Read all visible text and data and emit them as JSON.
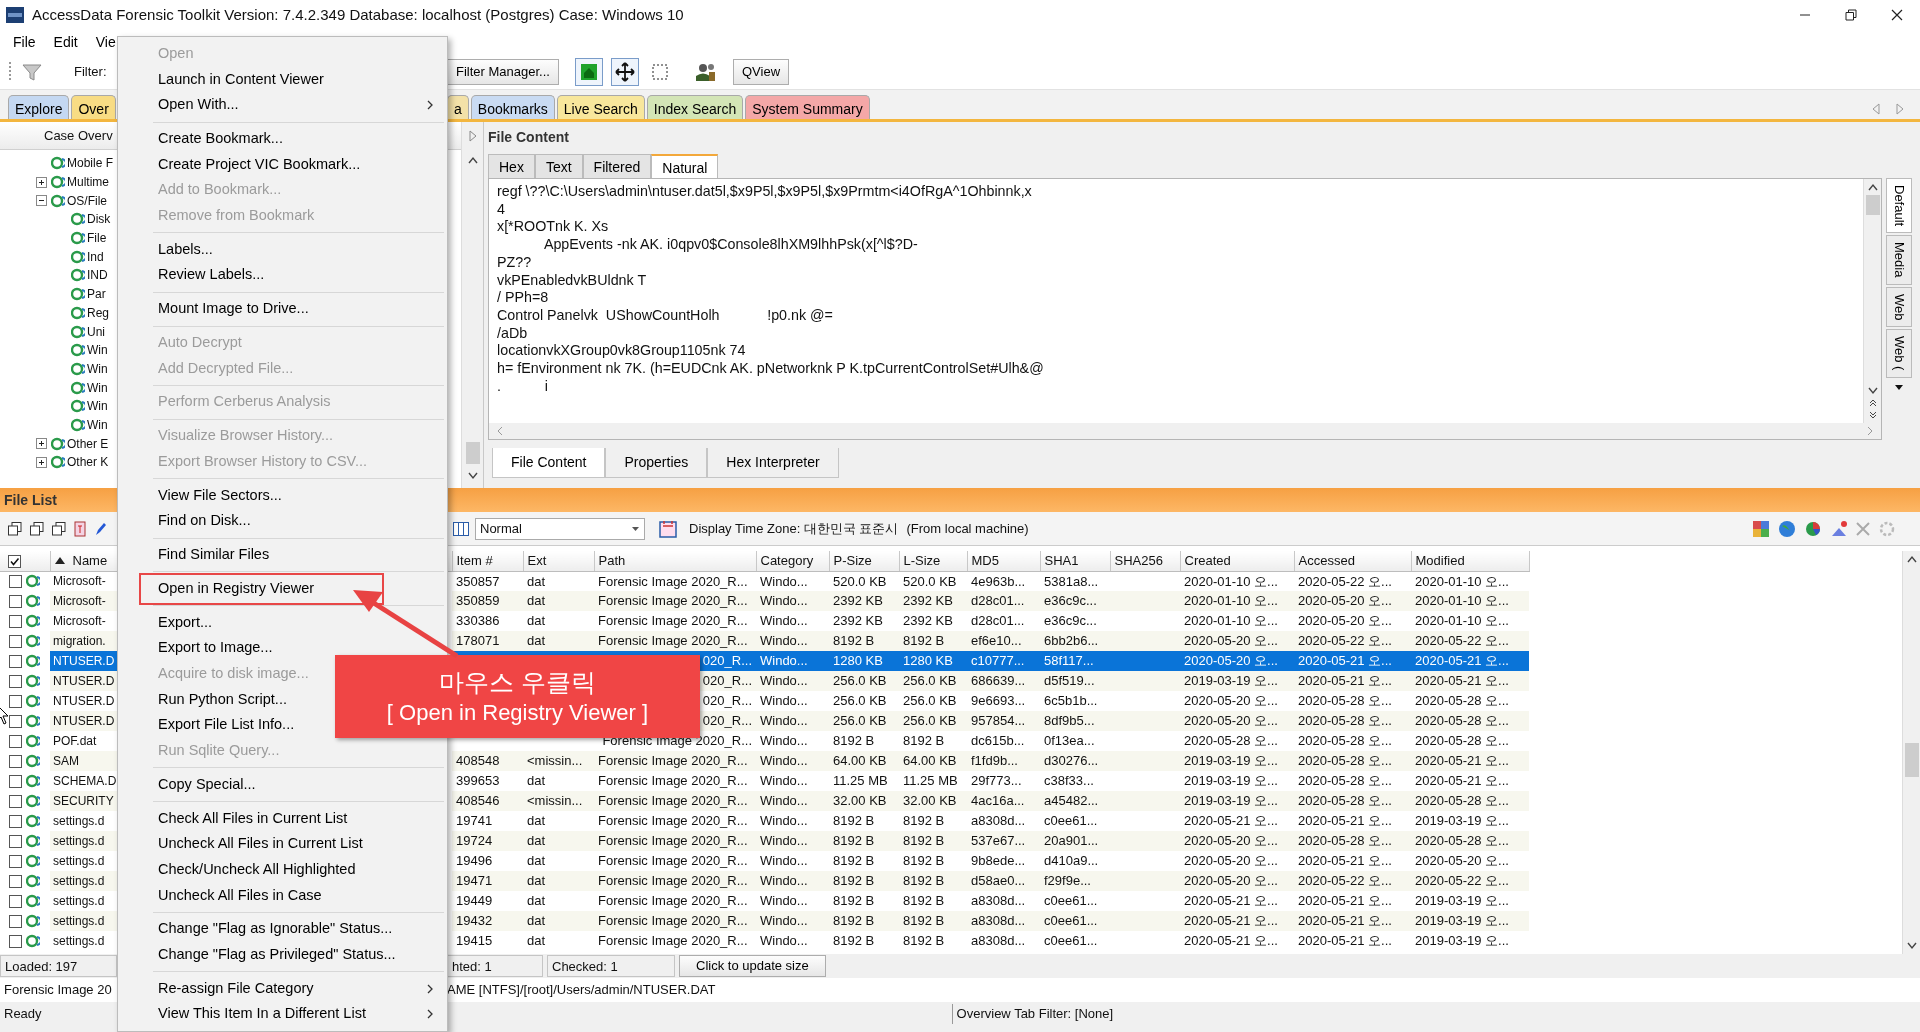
{
  "window": {
    "title": "AccessData Forensic Toolkit Version: 7.4.2.349 Database: localhost (Postgres) Case: Windows 10"
  },
  "menu_bar": [
    "File",
    "Edit",
    "Vie"
  ],
  "toolbar": {
    "filter_label": "Filter:",
    "filter_manager": "Filter Manager...",
    "qview": "QView"
  },
  "tabs": [
    {
      "label": "Explore",
      "color": "#c4d8f2"
    },
    {
      "label": "Over",
      "color": "#f8dc84"
    },
    {
      "label": "a",
      "color": "#f3e1a8"
    },
    {
      "label": "Bookmarks",
      "color": "#c9dbf3"
    },
    {
      "label": "Live Search",
      "color": "#f8e79c"
    },
    {
      "label": "Index Search",
      "color": "#d3e5b6"
    },
    {
      "label": "System Summary",
      "color": "#f4a7a7"
    }
  ],
  "tree": {
    "header": "Case Overv",
    "items": [
      {
        "label": "Mobile F"
      },
      {
        "label": "Multime",
        "expanded": false
      },
      {
        "label": "OS/File",
        "expanded": true,
        "children": [
          {
            "label": "Disk"
          },
          {
            "label": "File"
          },
          {
            "label": "Ind"
          },
          {
            "label": "IND"
          },
          {
            "label": "Par"
          },
          {
            "label": "Reg"
          },
          {
            "label": "Uni"
          },
          {
            "label": "Win"
          },
          {
            "label": "Win"
          },
          {
            "label": "Win"
          },
          {
            "label": "Win"
          },
          {
            "label": "Win"
          }
        ]
      },
      {
        "label": "Other E",
        "expanded": false
      },
      {
        "label": "Other K",
        "expanded": false
      }
    ]
  },
  "file_content": {
    "title": "File Content",
    "view_tabs": [
      {
        "label": "Hex",
        "selected": false
      },
      {
        "label": "Text",
        "selected": false
      },
      {
        "label": "Filtered",
        "selected": false
      },
      {
        "label": "Natural",
        "selected": true
      }
    ],
    "lines": [
      "regf \\??\\C:\\Users\\admin\\ntuser.dat5l,$x9P5l,$x9P5l,$x9Prmtm<i4OfRgA^1Ohbinnk,x",
      "4",
      "x[*ROOTnk K. Xs",
      "            AppEvents -nk AK. i0qpv0$Console8lhXM9lhhPsk(x[^l$?D-",
      "PZ??",
      "vkPEnabledvkBUldnk T",
      "/ PPh=8",
      "Control Panelvk  UShowCountHolh            !p0.nk @=",
      "/aDb",
      "locationvkXGroup0vk8Group1105nk 74",
      "h= fEnvironment nk 7K. (h=EUDCnk AK. pNetworknk P K.tpCurrentControlSet#Ulh&@",
      ".           i"
    ],
    "side_tabs": [
      {
        "label": "Default",
        "selected": true
      },
      {
        "label": "Media",
        "selected": false
      },
      {
        "label": "Web",
        "selected": false
      },
      {
        "label": "Web (",
        "selected": false
      }
    ],
    "bottom_tabs": [
      {
        "label": "File Content",
        "selected": true
      },
      {
        "label": "Properties",
        "selected": false
      },
      {
        "label": "Hex Interpreter",
        "selected": false
      }
    ]
  },
  "file_list": {
    "title": "File List",
    "view_select": "Normal",
    "time_zone_label": "Display Time Zone: 대한민국 표준시",
    "time_zone_note": "(From local machine)",
    "header_checked": true,
    "name_column": "Name",
    "columns": [
      "Item #",
      "Ext",
      "Path",
      "Category",
      "P-Size",
      "L-Size",
      "MD5",
      "SHA1",
      "SHA256",
      "Created",
      "Accessed",
      "Modified"
    ],
    "rows": [
      {
        "checked": false,
        "selected": false,
        "name": "Microsoft-",
        "cells": [
          "350857",
          "dat",
          "Forensic Image 2020_R...",
          "Windo...",
          "520.0 KB",
          "520.0 KB",
          "4e963b...",
          "5381a8...",
          null,
          "2020-01-10 오...",
          "2020-05-22 오...",
          "2020-01-10 오..."
        ]
      },
      {
        "checked": false,
        "selected": false,
        "name": "Microsoft-",
        "cells": [
          "350859",
          "dat",
          "Forensic Image 2020_R...",
          "Windo...",
          "2392 KB",
          "2392 KB",
          "d28c01...",
          "e36c9c...",
          null,
          "2020-01-10 오...",
          "2020-05-20 오...",
          "2020-01-10 오..."
        ]
      },
      {
        "checked": false,
        "selected": false,
        "name": "Microsoft-",
        "cells": [
          "330386",
          "dat",
          "Forensic Image 2020_R...",
          "Windo...",
          "2392 KB",
          "2392 KB",
          "d28c01...",
          "e36c9c...",
          null,
          "2020-01-10 오...",
          "2020-05-20 오...",
          "2020-01-10 오..."
        ]
      },
      {
        "checked": false,
        "selected": false,
        "name": "migration.",
        "cells": [
          "178071",
          "dat",
          "Forensic Image 2020_R...",
          "Windo...",
          "8192 B",
          "8192 B",
          "ef6e10...",
          "6bb2b6...",
          null,
          "2020-05-20 오...",
          "2020-05-22 오...",
          "2020-05-22 오..."
        ]
      },
      {
        "checked": false,
        "selected": true,
        "name": "NTUSER.D",
        "cells": [
          null,
          null,
          "020_R...",
          "Windo...",
          "1280 KB",
          "1280 KB",
          "c10777...",
          "58f117...",
          null,
          "2020-05-20 오...",
          "2020-05-21 오...",
          "2020-05-21 오..."
        ]
      },
      {
        "checked": false,
        "selected": false,
        "name": "NTUSER.D",
        "cells": [
          null,
          null,
          "020_R...",
          "Windo...",
          "256.0 KB",
          "256.0 KB",
          "686639...",
          "d5f519...",
          null,
          "2019-03-19 오...",
          "2020-05-21 오...",
          "2020-05-21 오..."
        ]
      },
      {
        "checked": false,
        "selected": false,
        "name": "NTUSER.D",
        "cells": [
          null,
          null,
          "020_R...",
          "Windo...",
          "256.0 KB",
          "256.0 KB",
          "9e6693...",
          "6c5b1b...",
          null,
          "2020-05-20 오...",
          "2020-05-28 오...",
          "2020-05-28 오..."
        ]
      },
      {
        "checked": false,
        "selected": false,
        "name": "NTUSER.D",
        "cells": [
          null,
          null,
          "020_R...",
          "Windo...",
          "256.0 KB",
          "256.0 KB",
          "957854...",
          "8df9b5...",
          null,
          "2020-05-20 오...",
          "2020-05-28 오...",
          "2020-05-28 오..."
        ]
      },
      {
        "checked": false,
        "selected": false,
        "name": "POF.dat",
        "cells": [
          null,
          null,
          "Forensic Image 2020_R...",
          "Windo...",
          "8192 B",
          "8192 B",
          "dc615b...",
          "0f13ea...",
          null,
          "2020-05-28 오...",
          "2020-05-28 오...",
          "2020-05-28 오..."
        ]
      },
      {
        "checked": false,
        "selected": false,
        "name": "SAM",
        "cells": [
          "408548",
          "<missin...",
          "Forensic Image 2020_R...",
          "Windo...",
          "64.00 KB",
          "64.00 KB",
          "f1fd9b...",
          "d30276...",
          null,
          "2019-03-19 오...",
          "2020-05-28 오...",
          "2020-05-21 오..."
        ]
      },
      {
        "checked": false,
        "selected": false,
        "name": "SCHEMA.D",
        "cells": [
          "399653",
          "dat",
          "Forensic Image 2020_R...",
          "Windo...",
          "11.25 MB",
          "11.25 MB",
          "29f773...",
          "c38f33...",
          null,
          "2019-03-19 오...",
          "2020-05-28 오...",
          "2020-05-21 오..."
        ]
      },
      {
        "checked": false,
        "selected": false,
        "name": "SECURITY",
        "cells": [
          "408546",
          "<missin...",
          "Forensic Image 2020_R...",
          "Windo...",
          "32.00 KB",
          "32.00 KB",
          "4ac16a...",
          "a45482...",
          null,
          "2019-03-19 오...",
          "2020-05-28 오...",
          "2020-05-28 오..."
        ]
      },
      {
        "checked": false,
        "selected": false,
        "name": "settings.d",
        "cells": [
          "19741",
          "dat",
          "Forensic Image 2020_R...",
          "Windo...",
          "8192 B",
          "8192 B",
          "a8308d...",
          "c0ee61...",
          null,
          "2020-05-21 오...",
          "2020-05-21 오...",
          "2019-03-19 오..."
        ]
      },
      {
        "checked": false,
        "selected": false,
        "name": "settings.d",
        "cells": [
          "19724",
          "dat",
          "Forensic Image 2020_R...",
          "Windo...",
          "8192 B",
          "8192 B",
          "537e67...",
          "20a901...",
          null,
          "2020-05-20 오...",
          "2020-05-28 오...",
          "2020-05-28 오..."
        ]
      },
      {
        "checked": false,
        "selected": false,
        "name": "settings.d",
        "cells": [
          "19496",
          "dat",
          "Forensic Image 2020_R...",
          "Windo...",
          "8192 B",
          "8192 B",
          "9b8ede...",
          "d410a9...",
          null,
          "2020-05-20 오...",
          "2020-05-21 오...",
          "2020-05-20 오..."
        ]
      },
      {
        "checked": false,
        "selected": false,
        "name": "settings.d",
        "cells": [
          "19471",
          "dat",
          "Forensic Image 2020_R...",
          "Windo...",
          "8192 B",
          "8192 B",
          "d58ae0...",
          "f29f9e...",
          null,
          "2020-05-20 오...",
          "2020-05-22 오...",
          "2020-05-22 오..."
        ]
      },
      {
        "checked": false,
        "selected": false,
        "name": "settings.d",
        "cells": [
          "19449",
          "dat",
          "Forensic Image 2020_R...",
          "Windo...",
          "8192 B",
          "8192 B",
          "a8308d...",
          "c0ee61...",
          null,
          "2020-05-21 오...",
          "2020-05-21 오...",
          "2019-03-19 오..."
        ]
      },
      {
        "checked": false,
        "selected": false,
        "name": "settings.d",
        "cells": [
          "19432",
          "dat",
          "Forensic Image 2020_R...",
          "Windo...",
          "8192 B",
          "8192 B",
          "a8308d...",
          "c0ee61...",
          null,
          "2020-05-21 오...",
          "2020-05-21 오...",
          "2019-03-19 오..."
        ]
      },
      {
        "checked": false,
        "selected": false,
        "name": "settings.d",
        "cells": [
          "19415",
          "dat",
          "Forensic Image 2020_R...",
          "Windo...",
          "8192 B",
          "8192 B",
          "a8308d...",
          "c0ee61...",
          null,
          "2020-05-21 오...",
          "2020-05-21 오...",
          "2019-03-19 오..."
        ]
      }
    ]
  },
  "status": {
    "loaded": "Loaded: 197",
    "highlighted": "hted: 1",
    "checked": "Checked: 1",
    "update_button": "Click to update size",
    "source": "Forensic Image 20",
    "path": "AME [NTFS]/[root]/Users/admin/NTUSER.DAT",
    "ready": "Ready",
    "filter": "Overview Tab Filter: [None]"
  },
  "context_menu": {
    "groups": [
      [
        {
          "label": "Open",
          "disabled": true,
          "submenu": false,
          "highlighted": false
        },
        {
          "label": "Launch in Content Viewer",
          "disabled": false,
          "submenu": false,
          "highlighted": false
        },
        {
          "label": "Open With...",
          "disabled": false,
          "submenu": true,
          "highlighted": false
        }
      ],
      [
        {
          "label": "Create Bookmark...",
          "disabled": false,
          "submenu": false,
          "highlighted": false
        },
        {
          "label": "Create Project VIC Bookmark...",
          "disabled": false,
          "submenu": false,
          "highlighted": false
        },
        {
          "label": "Add to Bookmark...",
          "disabled": true,
          "submenu": false,
          "highlighted": false
        },
        {
          "label": "Remove from Bookmark",
          "disabled": true,
          "submenu": false,
          "highlighted": false
        }
      ],
      [
        {
          "label": "Labels...",
          "disabled": false,
          "submenu": false,
          "highlighted": false
        },
        {
          "label": "Review Labels...",
          "disabled": false,
          "submenu": false,
          "highlighted": false
        }
      ],
      [
        {
          "label": "Mount Image to Drive...",
          "disabled": false,
          "submenu": false,
          "highlighted": false
        }
      ],
      [
        {
          "label": "Auto Decrypt",
          "disabled": true,
          "submenu": false,
          "highlighted": false
        },
        {
          "label": "Add Decrypted File...",
          "disabled": true,
          "submenu": false,
          "highlighted": false
        }
      ],
      [
        {
          "label": "Perform Cerberus Analysis",
          "disabled": true,
          "submenu": false,
          "highlighted": false
        }
      ],
      [
        {
          "label": "Visualize Browser History...",
          "disabled": true,
          "submenu": false,
          "highlighted": false
        },
        {
          "label": "Export Browser History to CSV...",
          "disabled": true,
          "submenu": false,
          "highlighted": false
        }
      ],
      [
        {
          "label": "View File Sectors...",
          "disabled": false,
          "submenu": false,
          "highlighted": false
        },
        {
          "label": "Find on Disk...",
          "disabled": false,
          "submenu": false,
          "highlighted": false
        }
      ],
      [
        {
          "label": "Find Similar Files",
          "disabled": false,
          "submenu": false,
          "highlighted": false
        }
      ],
      [
        {
          "label": "Open in Registry Viewer",
          "disabled": false,
          "submenu": false,
          "highlighted": true
        }
      ],
      [
        {
          "label": "Export...",
          "disabled": false,
          "submenu": false,
          "highlighted": false
        },
        {
          "label": "Export to Image...",
          "disabled": false,
          "submenu": false,
          "highlighted": false
        },
        {
          "label": "Acquire to disk image...",
          "disabled": true,
          "submenu": false,
          "highlighted": false
        },
        {
          "label": "Run Python Script...",
          "disabled": false,
          "submenu": false,
          "highlighted": false
        },
        {
          "label": "Export File List Info...",
          "disabled": false,
          "submenu": false,
          "highlighted": false
        },
        {
          "label": "Run Sqlite Query...",
          "disabled": true,
          "submenu": false,
          "highlighted": false
        }
      ],
      [
        {
          "label": "Copy Special...",
          "disabled": false,
          "submenu": false,
          "highlighted": false
        }
      ],
      [
        {
          "label": "Check All Files in Current List",
          "disabled": false,
          "submenu": false,
          "highlighted": false
        },
        {
          "label": "Uncheck All Files in Current List",
          "disabled": false,
          "submenu": false,
          "highlighted": false
        },
        {
          "label": "Check/Uncheck All Highlighted",
          "disabled": false,
          "submenu": false,
          "highlighted": false
        },
        {
          "label": "Uncheck All Files in Case",
          "disabled": false,
          "submenu": false,
          "highlighted": false
        }
      ],
      [
        {
          "label": "Change \"Flag as Ignorable\" Status...",
          "disabled": false,
          "submenu": false,
          "highlighted": false
        },
        {
          "label": "Change \"Flag as Privileged\" Status...",
          "disabled": false,
          "submenu": false,
          "highlighted": false
        }
      ],
      [
        {
          "label": "Re-assign File Category",
          "disabled": false,
          "submenu": true,
          "highlighted": false
        },
        {
          "label": "View This Item In a Different List",
          "disabled": false,
          "submenu": true,
          "highlighted": false
        }
      ]
    ]
  },
  "annotation": {
    "lines": [
      "마우스 우클릭",
      "[ Open in Registry Viewer ]"
    ]
  }
}
